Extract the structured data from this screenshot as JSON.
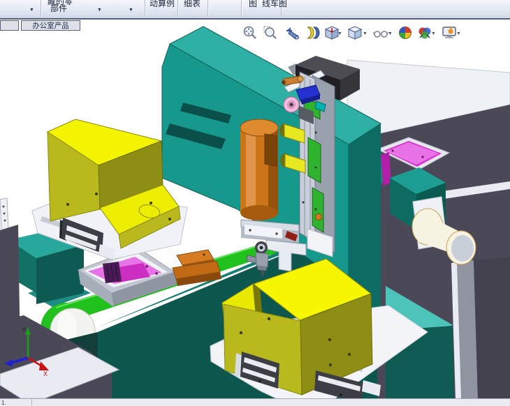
{
  "toolbar": {
    "component_button_line1": "藏的零",
    "component_button_line2": "部件",
    "motion_study_fragment": "动算例",
    "bom_fragment": "细表",
    "view_fragment": "图",
    "line_diagram_fragment": "线车图",
    "dropdown_glyph": "▼"
  },
  "tab_row": {
    "document_tab": "办公室产品"
  },
  "heads_up_toolbar": {
    "dropdown_glyph": "▼",
    "icons": [
      "zoom-to-fit",
      "zoom-to-area",
      "previous-view",
      "section-view",
      "view-orientation",
      "display-style",
      "hide-show-items",
      "edit-appearance",
      "apply-scene",
      "view-settings"
    ]
  },
  "viewport": {
    "triad": {
      "x_label": "X",
      "y_label": "Y"
    }
  },
  "status_bar": {
    "sheet_tab": "1."
  },
  "colors": {
    "gantry_teal": "#17988d",
    "gantry_teal_dark": "#0c6b62",
    "belt_green": "#20c11d",
    "fixture_yellow": "#f4f402",
    "cylinder_orange": "#cc7418",
    "product_magenta": "#d935cc",
    "wall_purple_gray": "#4b4858",
    "plate_white": "#f0f2f7"
  }
}
